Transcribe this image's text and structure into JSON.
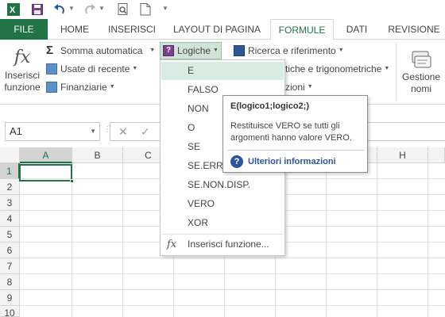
{
  "toolbar": {
    "icons": [
      "excel-icon",
      "save-icon",
      "undo-icon",
      "redo-icon",
      "print-preview-icon",
      "open-icon",
      "customize-qat-icon"
    ]
  },
  "tabs": [
    {
      "label": "FILE"
    },
    {
      "label": "HOME"
    },
    {
      "label": "INSERISCI"
    },
    {
      "label": "LAYOUT DI PAGINA"
    },
    {
      "label": "FORMULE"
    },
    {
      "label": "DATI"
    },
    {
      "label": "REVISIONE"
    }
  ],
  "active_tab": "FORMULE",
  "ribbon": {
    "insert_function": {
      "icon": "fx",
      "line1": "Inserisci",
      "line2": "funzione"
    },
    "autosum": "Somma automatica",
    "recent": "Usate di recente",
    "financial": "Finanziarie",
    "logical": "Logiche",
    "lookup": "Ricerca e riferimento",
    "math_partial": "tiche e trigonometriche",
    "more_partial": "zioni",
    "name_manager": {
      "line1": "Gestione",
      "line2": "nomi"
    }
  },
  "formula_bar": {
    "name_box": "A1",
    "cancel": "✕",
    "enter": "✓"
  },
  "grid": {
    "columns": [
      "A",
      "B",
      "C",
      "D",
      "E",
      "F",
      "G",
      "H"
    ],
    "rows": [
      "1",
      "2",
      "3",
      "4",
      "5",
      "6",
      "7",
      "8",
      "9",
      "10"
    ],
    "selected_cell": "A1"
  },
  "menu": {
    "items": [
      "E",
      "FALSO",
      "NON",
      "O",
      "SE",
      "SE.ERRORE",
      "SE.NON.DISP.",
      "VERO",
      "XOR"
    ],
    "highlighted": "E",
    "insert_function_label": "Inserisci funzione..."
  },
  "tooltip": {
    "title": "E(logico1;logico2;)",
    "description": "Restituisce VERO se tutti gli argomenti hanno valore VERO.",
    "help_link": "Ulteriori informazioni"
  },
  "colors": {
    "excel_green": "#217346",
    "menu_highlight": "#d8ece1",
    "link_blue": "#2a5699"
  }
}
